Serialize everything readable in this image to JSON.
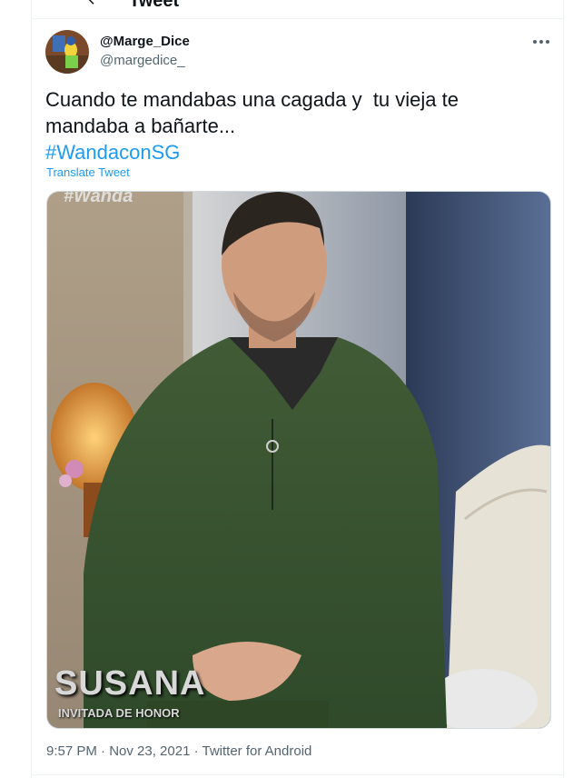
{
  "header": {
    "title": "Tweet"
  },
  "tweet": {
    "author": {
      "display_name": "@Marge_Dice",
      "handle": "@margedice_"
    },
    "text": "Cuando te mandabas una cagada y  tu vieja te mandaba a bañarte...",
    "hashtag": "#WandaconSG",
    "translate_label": "Translate Tweet",
    "media": {
      "overlay_tag": "#Wanda",
      "lower_third_name": "SUSANA",
      "lower_third_sub": "INVITADA DE HONOR"
    },
    "timestamp": "9:57 PM · Nov 23, 2021 · ",
    "source": "Twitter for Android"
  },
  "icons": {
    "back": "arrow-left-icon",
    "more": "more-horizontal-icon"
  },
  "colors": {
    "link": "#1d9bf0",
    "muted": "#536471",
    "text": "#0f1419"
  }
}
